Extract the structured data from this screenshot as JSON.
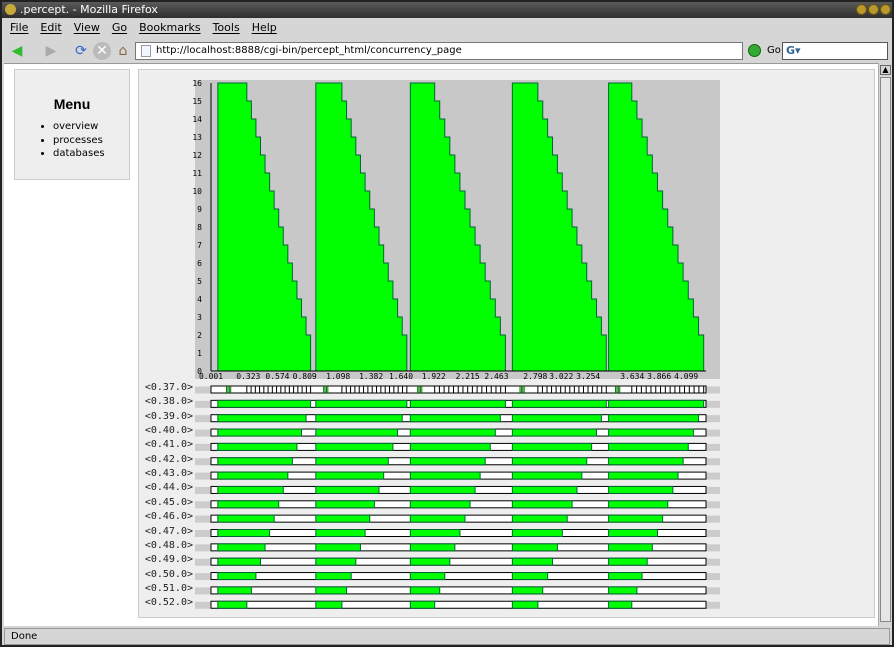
{
  "window": {
    "title": ".percept. - Mozilla Firefox"
  },
  "menubar": [
    "File",
    "Edit",
    "View",
    "Go",
    "Bookmarks",
    "Tools",
    "Help"
  ],
  "navbar": {
    "url": "http://localhost:8888/cgi-bin/percept_html/concurrency_page",
    "go_label": "Go",
    "search_value": ""
  },
  "sidebar": {
    "title": "Menu",
    "items": [
      "overview",
      "processes",
      "databases"
    ]
  },
  "status": "Done",
  "colors": {
    "active": "#00ff00",
    "chart_bg": "#c8c8c8"
  },
  "chart_data": {
    "type": "area",
    "ylim": [
      0,
      16
    ],
    "yticks": [
      "0",
      "1",
      "2",
      "3",
      "4",
      "5",
      "6",
      "7",
      "8",
      "9",
      "10",
      "11",
      "12",
      "13",
      "14",
      "15",
      "16"
    ],
    "xlim": [
      0.001,
      4.27
    ],
    "xticks": [
      "0.001",
      "0.323",
      "0.574",
      "0.809",
      "1.098",
      "1.382",
      "1.640",
      "1.922",
      "2.215",
      "2.463",
      "2.798",
      "3.022",
      "3.254",
      "3.634",
      "3.866",
      "4.099"
    ],
    "cycles": [
      {
        "start": 0.06,
        "peak_end": 0.31,
        "end": 0.86,
        "peak": 16,
        "min": 2
      },
      {
        "start": 0.905,
        "peak_end": 1.13,
        "end": 1.69,
        "peak": 16,
        "min": 2
      },
      {
        "start": 1.72,
        "peak_end": 1.93,
        "end": 2.54,
        "peak": 16,
        "min": 2
      },
      {
        "start": 2.6,
        "peak_end": 2.82,
        "end": 3.41,
        "peak": 16,
        "min": 2
      },
      {
        "start": 3.43,
        "peak_end": 3.63,
        "end": 4.25,
        "peak": 16,
        "min": 2
      }
    ],
    "processes": [
      "<0.37.0>",
      "<0.38.0>",
      "<0.39.0>",
      "<0.40.0>",
      "<0.41.0>",
      "<0.42.0>",
      "<0.43.0>",
      "<0.44.0>",
      "<0.45.0>",
      "<0.46.0>",
      "<0.47.0>",
      "<0.48.0>",
      "<0.49.0>",
      "<0.50.0>",
      "<0.51.0>",
      "<0.52.0>"
    ]
  }
}
